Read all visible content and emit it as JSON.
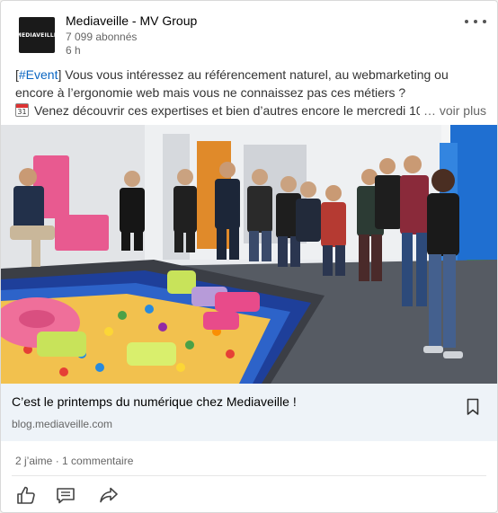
{
  "author": {
    "logo_text": "MEDIAVEILLE",
    "name": "Mediaveille - MV Group",
    "followers": "7 099 abonnés",
    "time": "6 h"
  },
  "post": {
    "hashtag_open": "[",
    "hashtag": "#Event",
    "hashtag_close": "]",
    "line1_rest": " Vous vous intéressez au référencement naturel, au webmarketing ou",
    "line2": "encore à l’ergonomie web mais vous ne connaissez pas ces métiers ?",
    "calendar_day": "31",
    "line3": "Venez découvrir ces expertises et bien d’autres encore le mercredi 10",
    "ellipsis": "…",
    "see_more": "voir plus"
  },
  "link_preview": {
    "title": "C’est le printemps du numérique chez Mediaveille !",
    "domain": "blog.mediaveille.com"
  },
  "social": {
    "likes": "2 j’aime",
    "separator": " · ",
    "comments": "1 commentaire"
  },
  "icons": {
    "more": "more-dots-icon",
    "calendar": "calendar-icon",
    "bookmark": "bookmark-icon",
    "like": "thumbs-up-icon",
    "comment": "comment-icon",
    "share": "share-arrow-icon"
  },
  "colors": {
    "hashtag": "#0a66c2",
    "link_box_bg": "#eef3f8",
    "text_secondary": "#666666"
  }
}
